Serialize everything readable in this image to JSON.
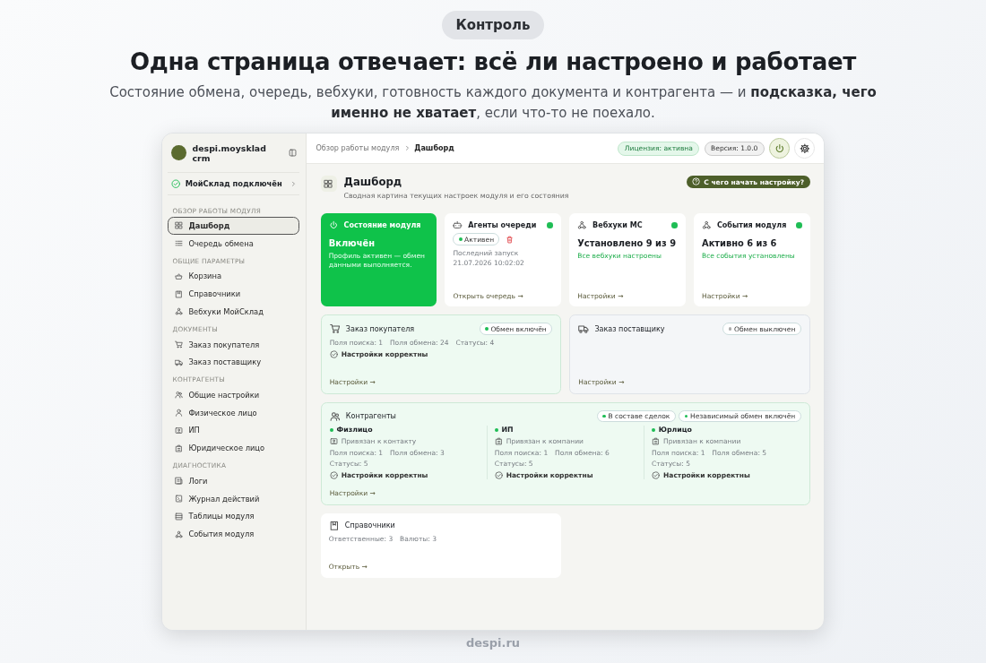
{
  "tag": "Контроль",
  "title": "Одна страница отвечает: всё ли настроено и работает",
  "lead": "Состояние обмена, очередь, вебхуки, готовность каждого документа и контрагента — и **подсказка, чего именно не хватает**, если что-то не поехало.",
  "app": {
    "sidebar": {
      "brand": "despi.moysklad crm",
      "connection": {
        "label": "МойСклад подключён",
        "connected": true
      },
      "sections": [
        {
          "title": "ОБЗОР РАБОТЫ МОДУЛЯ",
          "items": [
            {
              "label": "Дашборд",
              "selected": true
            },
            {
              "label": "Очередь обмена",
              "selected": false
            }
          ]
        },
        {
          "title": "ОБЩИЕ ПАРАМЕТРЫ",
          "items": [
            {
              "label": "Корзина",
              "selected": false
            },
            {
              "label": "Справочники",
              "selected": false
            },
            {
              "label": "Вебхуки МойСклад",
              "selected": false
            }
          ]
        },
        {
          "title": "ДОКУМЕНТЫ",
          "items": [
            {
              "label": "Заказ покупателя",
              "selected": false
            },
            {
              "label": "Заказ поставщику",
              "selected": false
            }
          ]
        },
        {
          "title": "КОНТРАГЕНТЫ",
          "items": [
            {
              "label": "Общие настройки",
              "selected": false
            },
            {
              "label": "Физическое лицо",
              "selected": false
            },
            {
              "label": "ИП",
              "selected": false
            },
            {
              "label": "Юридическое лицо",
              "selected": false
            }
          ]
        },
        {
          "title": "ДИАГНОСТИКА",
          "items": [
            {
              "label": "Логи",
              "selected": false
            },
            {
              "label": "Журнал действий",
              "selected": false
            },
            {
              "label": "Таблицы модуля",
              "selected": false
            },
            {
              "label": "События модуля",
              "selected": false
            }
          ]
        }
      ]
    },
    "breadcrumb": [
      "Обзор работы модуля",
      "Дашборд"
    ],
    "badges": [
      {
        "label": "Лицензия: активна",
        "kind": "success"
      },
      {
        "label": "Версия: 1.0.0",
        "kind": "neutral"
      }
    ],
    "power_on": true,
    "page": {
      "title": "Дашборд",
      "subtitle": "Сводная картина текущих настроек модуля и его состояния",
      "help_button": "С чего начать настройку?"
    },
    "status_card": {
      "title": "Состояние модуля",
      "value": "Включён",
      "note": "Профиль активен — обмен данными выполняется.",
      "on": true
    },
    "agents_card": {
      "title": "Агенты очереди",
      "on": true,
      "pill": {
        "label": "Активен",
        "on": true
      },
      "last_run": "Последний запуск 21.07.2026 10:02:02",
      "link": "Открыть очередь →"
    },
    "metric_cards": [
      {
        "title": "Вебхуки МС",
        "on": true,
        "value": "Установлено 9 из 9",
        "note": "Все вебхуки настроены",
        "link": "Настройки →"
      },
      {
        "title": "События модуля",
        "on": true,
        "value": "Активно 6 из 6",
        "note": "Все события установлены",
        "link": "Настройки →"
      }
    ],
    "documents": [
      {
        "title": "Заказ покупателя",
        "pill": {
          "label": "Обмен включён",
          "on": true
        },
        "stats": [
          "Поля поиска: 1",
          "Поля обмена: 24",
          "Статусы: 4"
        ],
        "check": "Настройки корректны",
        "link": "Настройки →"
      },
      {
        "title": "Заказ поставщику",
        "pill": {
          "label": "Обмен выключен",
          "on": false
        },
        "link": "Настройки →"
      }
    ],
    "counterparties": {
      "title": "Контрагенты",
      "pills": [
        {
          "label": "В составе сделок",
          "on": true
        },
        {
          "label": "Независимый обмен включён",
          "on": true
        }
      ],
      "columns": [
        {
          "title": "Физлицо",
          "on": true,
          "binding": "Привязан к контакту",
          "stats": [
            "Поля поиска: 1",
            "Поля обмена: 3",
            "Статусы: 5"
          ],
          "check": "Настройки корректны"
        },
        {
          "title": "ИП",
          "on": true,
          "binding": "Привязан к компании",
          "stats": [
            "Поля поиска: 1",
            "Поля обмена: 6",
            "Статусы: 5"
          ],
          "check": "Настройки корректны"
        },
        {
          "title": "Юрлицо",
          "on": true,
          "binding": "Привязан к компании",
          "stats": [
            "Поля поиска: 1",
            "Поля обмена: 5",
            "Статусы: 5"
          ],
          "check": "Настройки корректны"
        }
      ],
      "link": "Настройки →"
    },
    "references": {
      "title": "Справочники",
      "stats": [
        "Ответственные: 3",
        "Валюты: 3"
      ],
      "link": "Открыть →"
    }
  },
  "footer": "despi.ru"
}
